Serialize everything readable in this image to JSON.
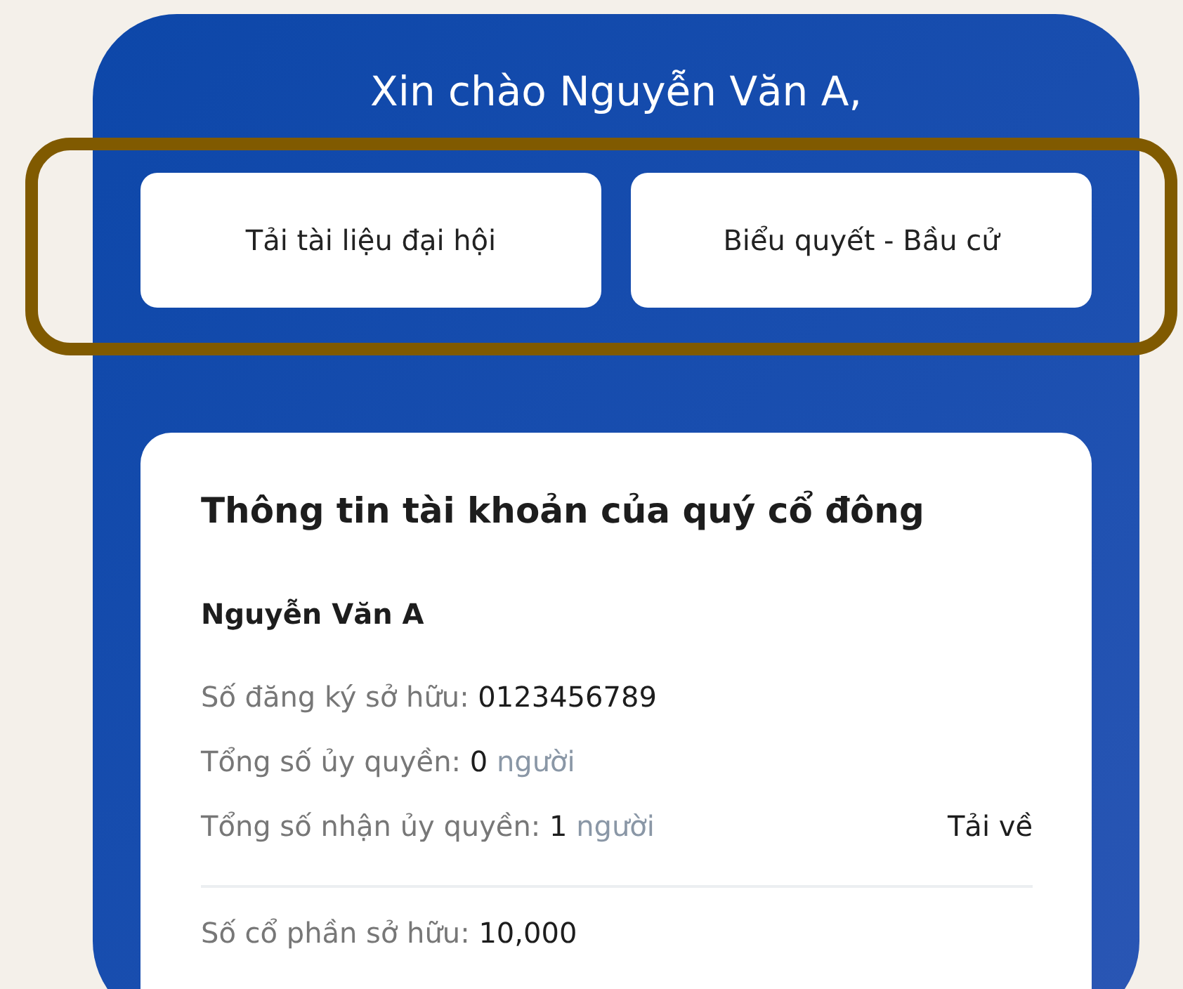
{
  "greeting": "Xin chào Nguyễn Văn A,",
  "actions": [
    {
      "label": "Tải tài liệu đại hội"
    },
    {
      "label": "Biểu quyết - Bầu cử"
    }
  ],
  "highlight": {
    "shown": true
  },
  "account_card": {
    "title": "Thông tin tài khoản của quý cổ đông",
    "name": "Nguyễn Văn A",
    "rows": [
      {
        "label": "Số đăng ký sở hữu:",
        "value": "0123456789"
      },
      {
        "label": "Tổng số ủy quyền:",
        "value": "0",
        "unit": "người"
      },
      {
        "label": "Tổng số nhận ủy quyền:",
        "value": "1",
        "unit": "người",
        "link": "Tải về"
      }
    ],
    "rows_after_divider": [
      {
        "label": "Số cổ phần sở hữu:",
        "value": "10,000"
      }
    ]
  }
}
